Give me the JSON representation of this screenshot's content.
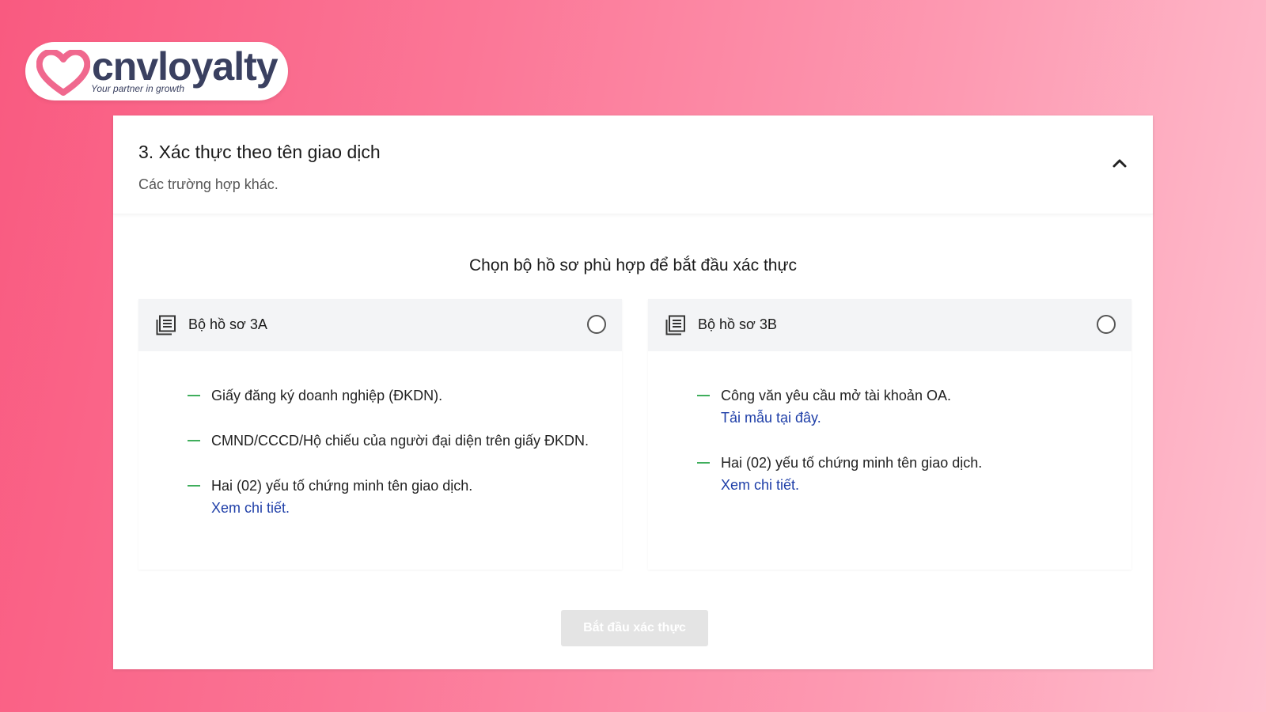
{
  "logo": {
    "name": "cnvloyalty",
    "tagline": "Your partner in growth"
  },
  "section": {
    "title": "3. Xác thực theo tên giao dịch",
    "subtitle": "Các trường hợp khác."
  },
  "choose_heading": "Chọn bộ hồ sơ phù hợp để bắt đầu xác thực",
  "options": [
    {
      "label": "Bộ hồ sơ 3A",
      "selected": false,
      "requirements": [
        {
          "text": "Giấy đăng ký doanh nghiệp (ĐKDN).",
          "link": ""
        },
        {
          "text": "CMND/CCCD/Hộ chiếu của người đại diện trên giấy ĐKDN.",
          "link": ""
        },
        {
          "text": "Hai (02) yếu tố chứng minh tên giao dịch.",
          "link": "Xem chi tiết."
        }
      ]
    },
    {
      "label": "Bộ hồ sơ 3B",
      "selected": false,
      "requirements": [
        {
          "text": "Công văn yêu cầu mở tài khoản OA.",
          "link": "Tải mẫu tại đây."
        },
        {
          "text": "Hai (02) yếu tố chứng minh tên giao dịch.",
          "link": "Xem chi tiết."
        }
      ]
    }
  ],
  "start_button": "Bắt đầu xác thực",
  "colors": {
    "bullet": "#3fae5c",
    "link": "#1f3fa8",
    "brand_pink": "#f0688e",
    "logo_text": "#3a4060"
  }
}
